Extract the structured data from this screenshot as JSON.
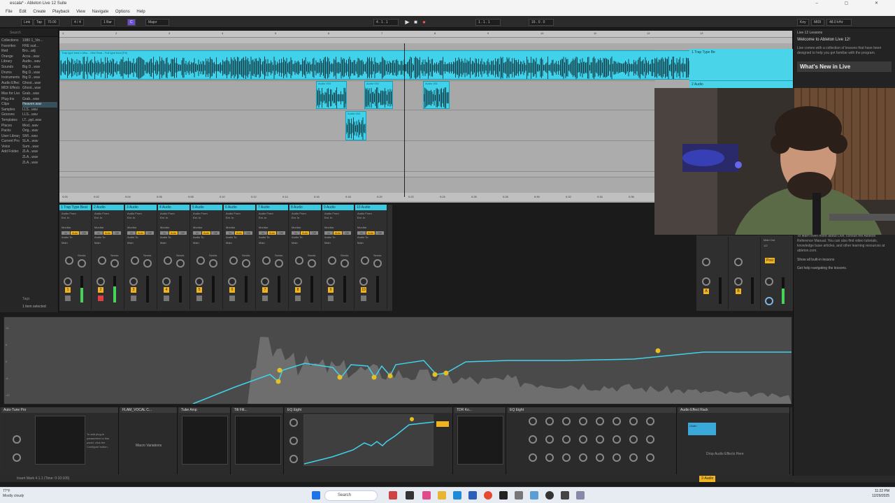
{
  "window": {
    "title": "escala* - Ableton Live 12 Suite"
  },
  "menu": [
    "File",
    "Edit",
    "Create",
    "Playback",
    "View",
    "Navigate",
    "Options",
    "Help"
  ],
  "control_bar": {
    "link": "Link",
    "tap": "Tap",
    "tempo": "70.00",
    "time_sig": "4 / 4",
    "metronome": "1 Bar",
    "key": "C",
    "scale": "Major",
    "position": "4 . 1 . 1",
    "loop_start": "1 . 1 . 1",
    "loop_length": "16 . 0 . 0",
    "key_label": "Key",
    "midi_label": "MIDI",
    "cpu": "48.0 kHz"
  },
  "browser": {
    "search_placeholder": "Search",
    "places": [
      "Collections",
      "Favorites",
      "Red",
      "Orange",
      "Library",
      "Sounds",
      "Drums",
      "Instruments",
      "Audio Effects",
      "MIDI Effects",
      "Max for Live",
      "Plug-Ins",
      "Clips",
      "Samples",
      "Grooves",
      "Templates",
      "Places",
      "Packs",
      "User Library",
      "Current Project",
      "Voice",
      "Add Folder..."
    ],
    "items": [
      "1980 1_Vin...",
      "FRE sud...",
      "Bro...adj",
      "Acou...wav",
      "Audio...wav",
      "Big D...wav",
      "Big D...wav",
      "Big D...wav",
      "Ghost...wav",
      "Ghost...wav",
      "Grab...wav",
      "Grab...wav",
      "Heaven.wav",
      "LLS...wav",
      "LLS...wav",
      "LT...ppl..wav",
      "Mod...wav",
      "Orig...wav",
      "SMI...wav",
      "SLA...wav",
      "Sum...wav",
      "ZLA...wav",
      "ZLA...wav",
      "ZLA...wav"
    ],
    "selected_item": "Heaven.wav",
    "tags_label": "Tags",
    "status": "1 item selected"
  },
  "arrangement": {
    "main_clip_name": "Trap type beat x Mac - Vibe Beat - Full type beat [F#]",
    "short_clips": [
      "Audio 003",
      "Audio 002",
      "Audio 001",
      "Audio 004"
    ],
    "time_labels": [
      "0:00",
      "0:02",
      "0:04",
      "0:06",
      "0:08",
      "0:10",
      "0:12",
      "0:14",
      "0:16",
      "0:18",
      "0:20",
      "0:22",
      "0:24",
      "0:26",
      "0:28",
      "0:30",
      "0:32",
      "0:34",
      "0:36"
    ],
    "bar_labels": [
      "1",
      "2",
      "3",
      "4",
      "5",
      "6",
      "7",
      "8",
      "9",
      "10",
      "11",
      "12",
      "13"
    ],
    "track_headers": [
      "1 Trap Type Be",
      "2 Audio"
    ]
  },
  "mixer": {
    "tracks": [
      {
        "name": "1 Trap Type Beat",
        "num": "1",
        "level": 0.55
      },
      {
        "name": "2 Audio",
        "num": "2",
        "level": 0.6
      },
      {
        "name": "3 Audio",
        "num": "3",
        "level": 0.0
      },
      {
        "name": "4 Audio",
        "num": "4",
        "level": 0.0
      },
      {
        "name": "5 Audio",
        "num": "5",
        "level": 0.0
      },
      {
        "name": "6 Audio",
        "num": "6",
        "level": 0.0
      },
      {
        "name": "7 Audio",
        "num": "7",
        "level": 0.0
      },
      {
        "name": "8 Audio",
        "num": "8",
        "level": 0.0
      },
      {
        "name": "9 Audio",
        "num": "9",
        "level": 0.0
      },
      {
        "name": "10 Audio",
        "num": "10",
        "level": 0.0
      }
    ],
    "audio_from": "Audio From",
    "ext_in": "Ext. In",
    "monitor": "Monitor",
    "in": "In",
    "auto": "Auto",
    "off": "Off",
    "audio_to": "Audio To",
    "master": "Main",
    "sends": "Sends",
    "returns": [
      {
        "name": "A",
        "num": "A"
      },
      {
        "name": "B",
        "num": "B"
      }
    ],
    "main_out": "Main Out",
    "cue_out": "1/2",
    "post": "Post"
  },
  "help": {
    "title": "Live 12 Lessons",
    "welcome": "Welcome to Ableton Live 12!",
    "intro": "Live comes with a collection of lessons that have been designed to help you get familiar with the program.",
    "whats_new": "What's New in Live",
    "more": "To learn even more about Live, consult the Ableton Reference Manual. You can also find video tutorials, knowledge base articles, and other learning resources at ableton.com.",
    "show_all": "Show all built-in lessons",
    "get_help": "Get help navigating the lessons."
  },
  "eq_view": {
    "scale_labels": [
      "12",
      "6",
      "0",
      "-6",
      "-12"
    ]
  },
  "devices": [
    {
      "name": "Auto-Tune Pro",
      "preset": "Configure"
    },
    {
      "name": "FLAM_VOCAL C..."
    },
    {
      "name": "Tube Amp"
    },
    {
      "name": "Tilt Filt..."
    },
    {
      "name": "EQ Eight"
    },
    {
      "name": "TDR Ko..."
    },
    {
      "name": "EQ Eight"
    },
    {
      "name": "Audio Effect Rack"
    }
  ],
  "device_text": {
    "plugin_hint": "To add plug-in parameters to this panel, click the Configure button.",
    "macro_variations": "Macro Variations",
    "drop_here": "Drop Audio Effects Here",
    "chain": "Chain"
  },
  "status_bar": {
    "text": "Insert Mark 4.1.1 (Time: 0:10:105)",
    "track": "2-Audio"
  },
  "taskbar": {
    "search": "Search",
    "weather_temp": "77°F",
    "weather_desc": "Mostly cloudy",
    "time": "11:22 PM",
    "date": "12/29/2025"
  },
  "colors": {
    "accent": "#3fd2ea",
    "track_num": "#f2b41d",
    "meter": "#45d35a",
    "eq_curve": "#3fd2ea"
  }
}
